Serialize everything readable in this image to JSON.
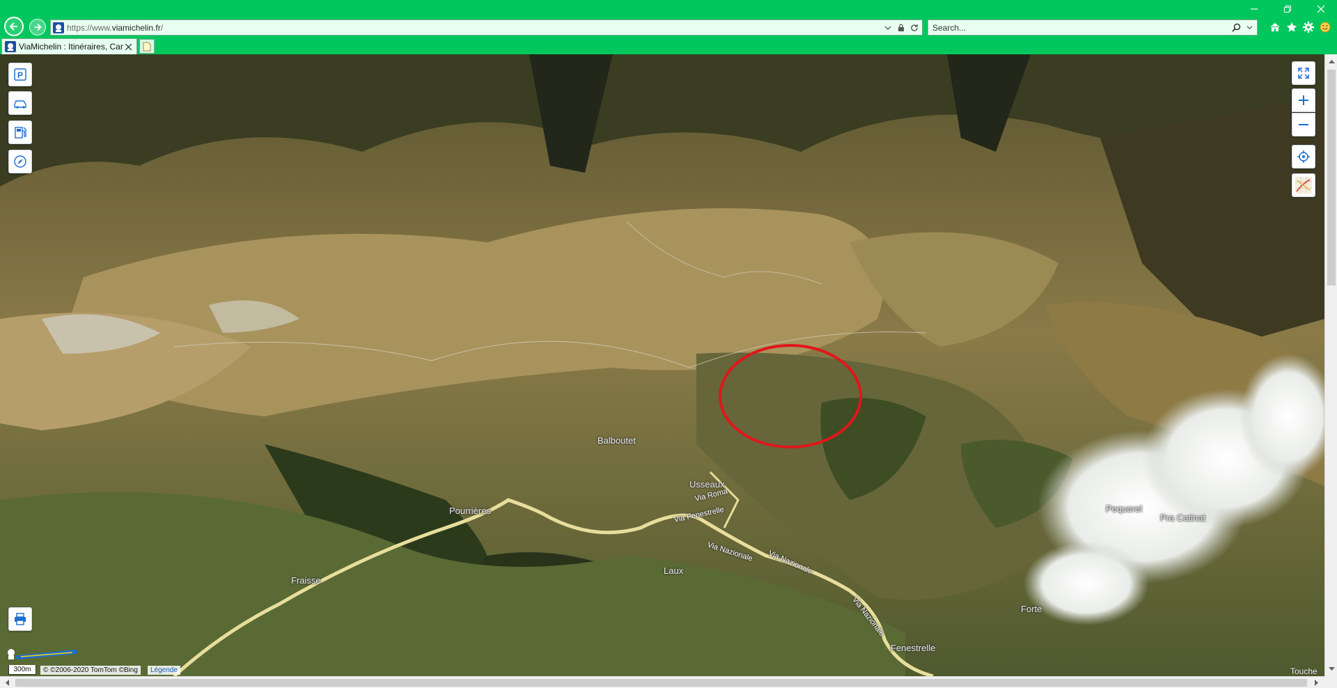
{
  "browser": {
    "url": {
      "prefix": "https://www.",
      "domain": "viamichelin.fr",
      "suffix": "/"
    },
    "search_placeholder": "Search...",
    "tab_title": "ViaMichelin : Itinéraires, Car...",
    "colors": {
      "chrome": "#00c75d",
      "address_bg": "#e9fff1"
    }
  },
  "map": {
    "places": [
      {
        "name": "Balboutet"
      },
      {
        "name": "Usseaux"
      },
      {
        "name": "Pourrières"
      },
      {
        "name": "Pequerel"
      },
      {
        "name": "Pra Catinat"
      },
      {
        "name": "Laux"
      },
      {
        "name": "Fraisse"
      },
      {
        "name": "Forte"
      },
      {
        "name": "Fenestrelle"
      }
    ],
    "roads": [
      {
        "name": "Via Roma"
      },
      {
        "name": "Via Fenestrelle"
      },
      {
        "name": "Via Nazionale"
      },
      {
        "name": "Via Nazionale"
      },
      {
        "name": "Via Nazionale"
      }
    ],
    "highlight_color": "#e0161b",
    "scale": "300m",
    "copyright": "© ©2006-2020 TomTom ©Bing",
    "legend_link": "Légende",
    "bottom_right_label": "Touche",
    "left_tools": [
      {
        "name": "parking-icon",
        "glyph": "P"
      },
      {
        "name": "car-icon"
      },
      {
        "name": "fuel-icon"
      },
      {
        "name": "compass-icon"
      }
    ],
    "right_tools": [
      {
        "name": "fullscreen-icon"
      },
      {
        "name": "zoom-in-icon",
        "glyph": "+"
      },
      {
        "name": "zoom-out-icon",
        "glyph": "−"
      },
      {
        "name": "locate-icon"
      },
      {
        "name": "map-layer-icon"
      }
    ]
  }
}
